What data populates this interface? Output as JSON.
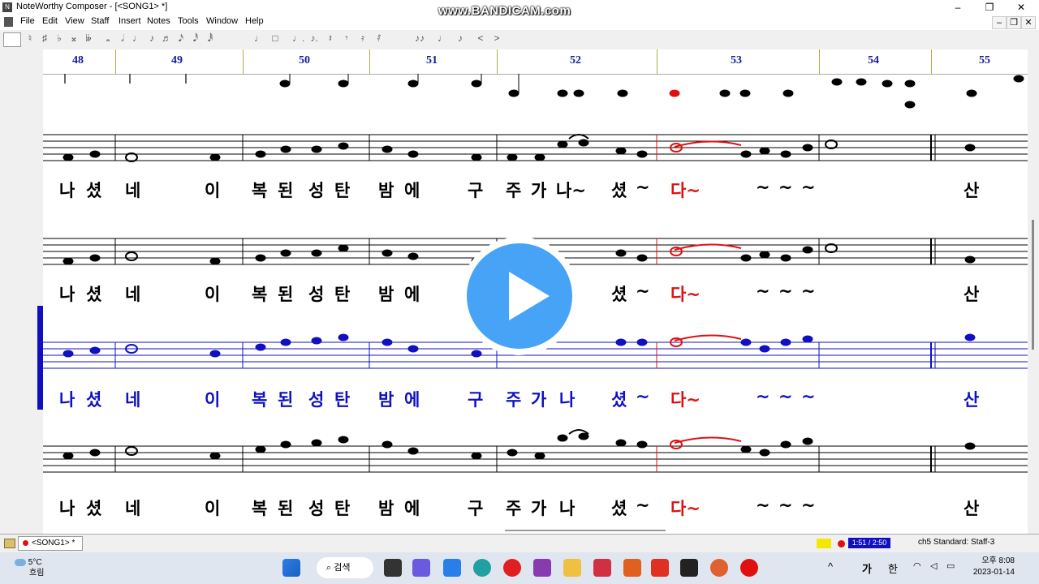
{
  "window": {
    "title": "NoteWorthy Composer - [<SONG1> *]",
    "watermark": "www.BANDICAM.com",
    "minimize": "–",
    "restore": "❐",
    "close": "✕"
  },
  "menu": {
    "items": [
      "File",
      "Edit",
      "View",
      "Staff",
      "Insert",
      "Notes",
      "Tools",
      "Window",
      "Help"
    ],
    "mdi_minimize": "–",
    "mdi_restore": "❐",
    "mdi_close": "✕"
  },
  "toolbar": {
    "symbols": [
      "♮",
      "♯",
      "♭",
      "𝄪",
      "𝄫",
      "𝅝",
      "𝅗𝅥",
      "♩",
      "♪",
      "♬",
      "𝅘𝅥𝅯",
      "𝅘𝅥𝅰",
      "𝅘𝅥𝅱",
      "♩",
      "□",
      "♩.",
      "♪.",
      "𝄽",
      "𝄾",
      "𝄿",
      "𝅀",
      "♪♪",
      "♩",
      "♪",
      "<",
      ">"
    ]
  },
  "ruler": {
    "measures": [
      "48",
      "49",
      "50",
      "51",
      "52",
      "53",
      "54",
      "55"
    ]
  },
  "lyrics": {
    "line": [
      "나",
      "셨",
      "네",
      "이",
      "복",
      "된",
      "성",
      "탄",
      "밤",
      "에",
      "구",
      "주",
      "가",
      "나~",
      "셨",
      "~",
      "다~",
      "~",
      "~",
      "~",
      "산"
    ],
    "line_blue": [
      "나",
      "셨",
      "네",
      "이",
      "복",
      "된",
      "성",
      "탄",
      "밤",
      "에",
      "구",
      "주",
      "가",
      "나",
      "셨",
      "~",
      "다~",
      "~",
      "~",
      "~",
      "산"
    ],
    "line4": [
      "나",
      "셨",
      "네",
      "이",
      "복",
      "된",
      "성",
      "탄",
      "밤",
      "에",
      "구",
      "주",
      "가",
      "나",
      "셨",
      "~",
      "다~",
      "~",
      "~",
      "~",
      "산"
    ]
  },
  "colors": {
    "active_staff": "#1010c0",
    "highlight": "#e01010",
    "measure_number": "#1a1a9a"
  },
  "status": {
    "tab_label": "<SONG1> *",
    "time": "1:51 / 2:50",
    "staff_info": "ch5 Standard: Staff-3"
  },
  "taskbar": {
    "temperature": "5°C",
    "weather_desc": "흐림",
    "search_label": "검색",
    "ime_lang": "가",
    "ime_mode": "한",
    "time": "오후 8:08",
    "date": "2023-01-14"
  },
  "icons": [
    "search-icon",
    "play-icon",
    "windows-start-icon",
    "wifi-icon",
    "speaker-icon",
    "battery-icon",
    "weather-cloud-icon"
  ]
}
